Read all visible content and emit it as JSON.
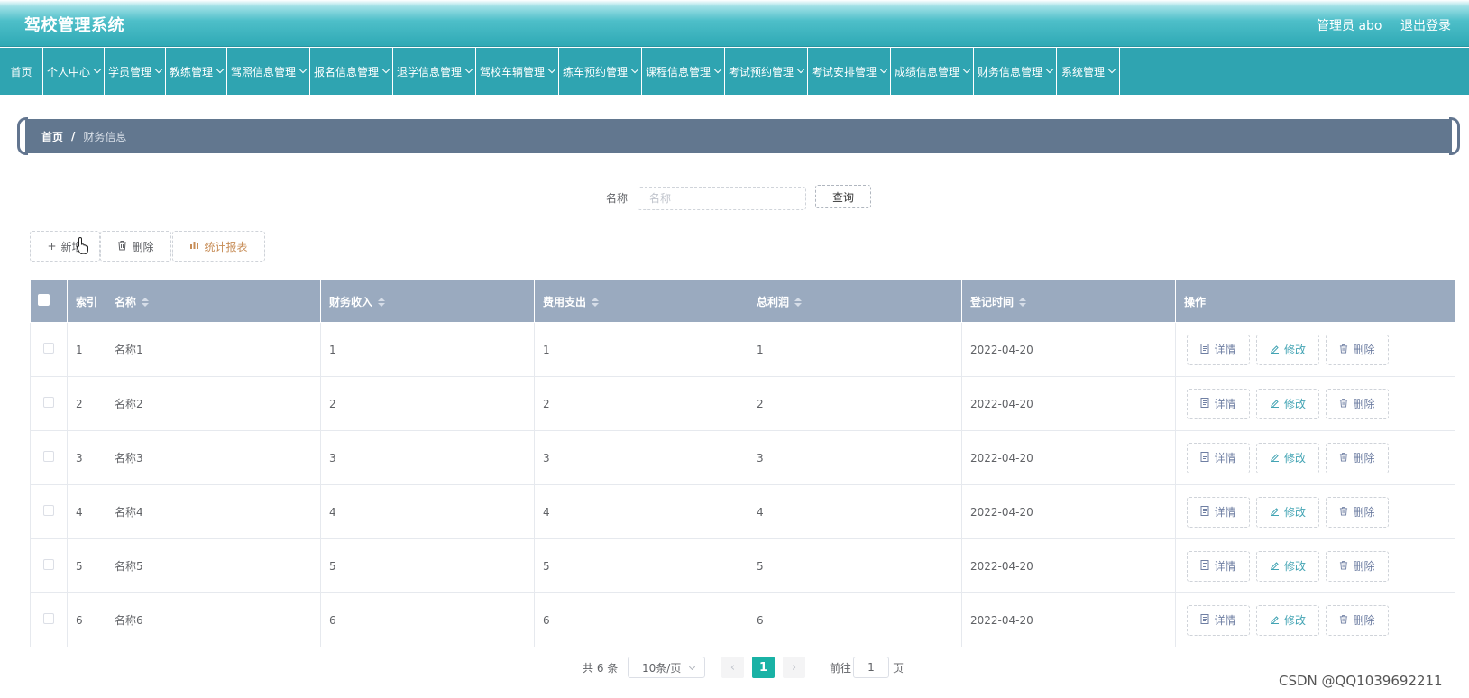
{
  "header": {
    "title": "驾校管理系统",
    "user": "管理员 abo",
    "logout": "退出登录"
  },
  "nav": [
    {
      "label": "首页",
      "dropdown": false
    },
    {
      "label": "个人中心",
      "dropdown": true
    },
    {
      "label": "学员管理",
      "dropdown": true
    },
    {
      "label": "教练管理",
      "dropdown": true
    },
    {
      "label": "驾照信息管理",
      "dropdown": true
    },
    {
      "label": "报名信息管理",
      "dropdown": true
    },
    {
      "label": "退学信息管理",
      "dropdown": true
    },
    {
      "label": "驾校车辆管理",
      "dropdown": true
    },
    {
      "label": "练车预约管理",
      "dropdown": true
    },
    {
      "label": "课程信息管理",
      "dropdown": true
    },
    {
      "label": "考试预约管理",
      "dropdown": true
    },
    {
      "label": "考试安排管理",
      "dropdown": true
    },
    {
      "label": "成绩信息管理",
      "dropdown": true
    },
    {
      "label": "财务信息管理",
      "dropdown": true
    },
    {
      "label": "系统管理",
      "dropdown": true
    }
  ],
  "breadcrumb": {
    "home": "首页",
    "sep": "/",
    "current": "财务信息"
  },
  "search": {
    "label": "名称",
    "placeholder": "名称",
    "value": "",
    "button": "查询"
  },
  "actions": {
    "add": "新增",
    "delete": "删除",
    "stats": "统计报表"
  },
  "table": {
    "headers": {
      "index": "索引",
      "name": "名称",
      "income": "财务收入",
      "expense": "费用支出",
      "profit": "总利润",
      "date": "登记时间",
      "ops": "操作"
    },
    "rows": [
      {
        "index": "1",
        "name": "名称1",
        "income": "1",
        "expense": "1",
        "profit": "1",
        "date": "2022-04-20"
      },
      {
        "index": "2",
        "name": "名称2",
        "income": "2",
        "expense": "2",
        "profit": "2",
        "date": "2022-04-20"
      },
      {
        "index": "3",
        "name": "名称3",
        "income": "3",
        "expense": "3",
        "profit": "3",
        "date": "2022-04-20"
      },
      {
        "index": "4",
        "name": "名称4",
        "income": "4",
        "expense": "4",
        "profit": "4",
        "date": "2022-04-20"
      },
      {
        "index": "5",
        "name": "名称5",
        "income": "5",
        "expense": "5",
        "profit": "5",
        "date": "2022-04-20"
      },
      {
        "index": "6",
        "name": "名称6",
        "income": "6",
        "expense": "6",
        "profit": "6",
        "date": "2022-04-20"
      }
    ],
    "row_ops": {
      "detail": "详情",
      "edit": "修改",
      "delete": "删除"
    }
  },
  "pagination": {
    "total": "共 6 条",
    "page_size": "10条/页",
    "current": "1",
    "goto_label": "前往",
    "goto_value": "1",
    "page_suffix": "页"
  },
  "watermark": "CSDN @QQ1039692211",
  "colors": {
    "header": "#2fa9b5",
    "nav": "#2fa4b1",
    "breadcrumb": "#62778f",
    "table_head": "#9aaabf",
    "active_page": "#19b2a5"
  }
}
